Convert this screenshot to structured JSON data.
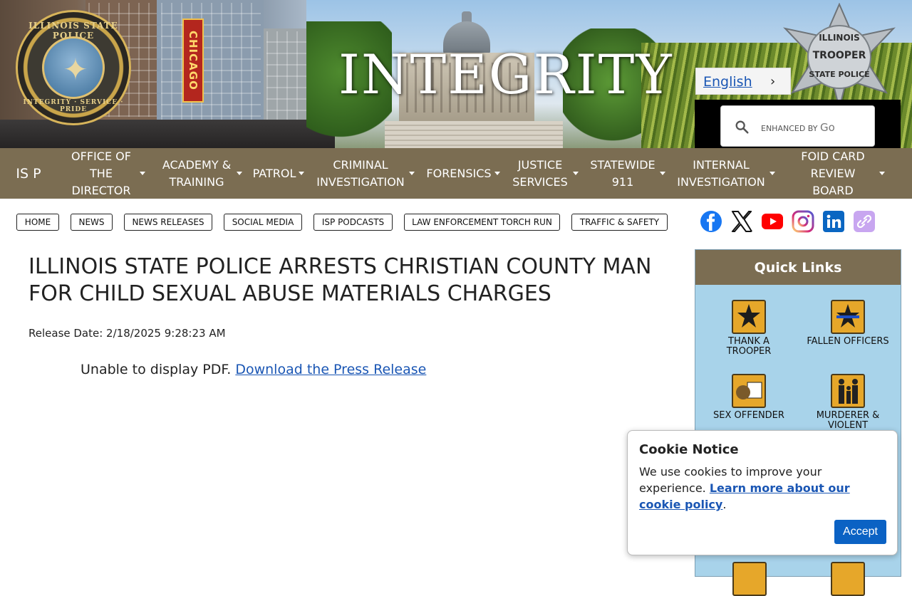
{
  "banner": {
    "title": "INTEGRITY",
    "seal": {
      "top_text": "ILLINOIS STATE POLICE",
      "bottom_text": "INTEGRITY · SERVICE · PRIDE"
    },
    "chicago_sign": "CHICAGO",
    "badge": {
      "line1": "ILLINOIS",
      "line2": "TROOPER",
      "line3": "STATE POLICE"
    }
  },
  "language": {
    "label": "English",
    "chevron": "›"
  },
  "search": {
    "prefix": "ENHANCED BY",
    "brand": "Go",
    "icon": "search-icon"
  },
  "nav": {
    "items": [
      {
        "label": "IS P",
        "caret": false
      },
      {
        "label": "OFFICE OF THE DIRECTOR",
        "caret": true
      },
      {
        "label": "ACADEMY & TRAINING",
        "caret": true
      },
      {
        "label": "PATROL",
        "caret": true
      },
      {
        "label": "CRIMINAL INVESTIGATION",
        "caret": true
      },
      {
        "label": "FORENSICS",
        "caret": true
      },
      {
        "label": "JUSTICE SERVICES",
        "caret": true
      },
      {
        "label": "STATEWIDE 911",
        "caret": true
      },
      {
        "label": "INTERNAL INVESTIGATION",
        "caret": true
      },
      {
        "label": "FOID CARD REVIEW BOARD",
        "caret": true
      }
    ]
  },
  "utility_links": [
    "HOME",
    "NEWS",
    "NEWS RELEASES",
    "SOCIAL MEDIA",
    "ISP PODCASTS",
    "LAW ENFORCEMENT TORCH RUN",
    "TRAFFIC & SAFETY"
  ],
  "social": [
    "facebook-icon",
    "x-icon",
    "youtube-icon",
    "instagram-icon",
    "linkedin-icon",
    "link-icon"
  ],
  "main": {
    "headline": "ILLINOIS STATE POLICE ARRESTS CHRISTIAN COUNTY MAN FOR CHILD SEXUAL ABUSE MATERIALS CHARGES",
    "release_date": "Release Date: 2/18/2025 9:28:23 AM",
    "pdf_text": "Unable to display PDF.",
    "pdf_link": "Download the Press Release"
  },
  "quick_links": {
    "title": "Quick Links",
    "items": [
      {
        "label": "THANK A TROOPER",
        "icon": "star-badge-icon"
      },
      {
        "label": "FALLEN OFFICERS",
        "icon": "mourning-badge-icon"
      },
      {
        "label": "SEX OFFENDER",
        "icon": "offender-icon"
      },
      {
        "label": "MURDERER & VIOLENT",
        "icon": "family-icon"
      }
    ]
  },
  "cookie": {
    "title": "Cookie Notice",
    "text": "We use cookies to improve your experience.",
    "link": "Learn more about our cookie policy",
    "after_link": ".",
    "accept": "Accept"
  },
  "colors": {
    "nav_bg": "#7b6d52",
    "quick_links_bg": "#a8d3ea",
    "link": "#1a56b4",
    "accept_button": "#0b62c4"
  }
}
